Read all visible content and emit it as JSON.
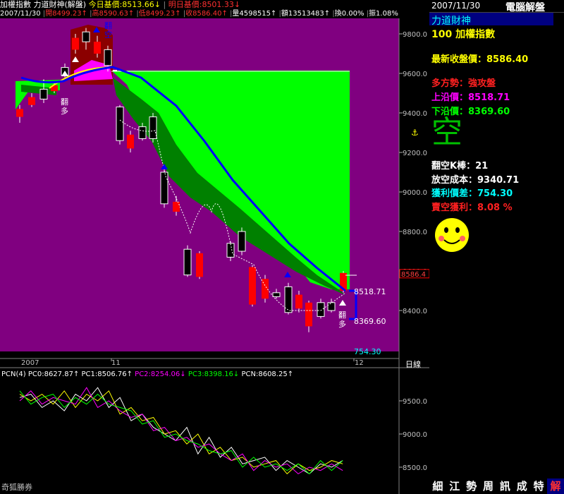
{
  "header": {
    "index_name": "加權指數",
    "indicator": "力道財神(解盤)",
    "today_base": "今日基價:8513.66↓",
    "tomorrow_base": "明日基價:8501.33↓",
    "date": "2007/11/30",
    "open": "開8499.23↑",
    "high": "高8590.63↑",
    "low": "低8499.23↑",
    "close": "收8586.40↑",
    "volume": "量4598515↑",
    "amount": "額13513483↑",
    "turnover": "換0.00%",
    "amplitude": "振1.08%"
  },
  "main_chart": {
    "y_ticks": [
      "9800.0",
      "9600.0",
      "9400.0",
      "9200.0",
      "9000.0",
      "8800.0",
      "8600.0",
      "8400.0"
    ],
    "current_price_tag": "8586.4",
    "upper_label": "8518.71",
    "lower_label": "8369.60",
    "profit_label": "754.30",
    "flip_long_label": "翻多",
    "flip_short_label": "翻空",
    "x_labels": [
      "2007",
      "11",
      "12"
    ],
    "period": "日線"
  },
  "sub_chart": {
    "legend": {
      "name": "PCN(4)",
      "pc0": "PC0:8627.87↑",
      "pc1": "PC1:8506.76↑",
      "pc2": "PC2:8254.06↓",
      "pc3": "PC3:8398.16↓",
      "pcn": "PCN:8608.25↑"
    },
    "y_ticks": [
      "9500.0",
      "9000.0",
      "8500.0"
    ],
    "broker": "奇狐勝券"
  },
  "side": {
    "date": "2007/11/30",
    "title": "電腦解盤",
    "indicator": "力道財神",
    "symbol": "100 加權指數",
    "last_close": "最新收盤價：8586.40",
    "trend": "多方勢：強攻盤",
    "upper": "上沿價：8518.71",
    "lower": "下沿價：8369.60",
    "state_char": "空",
    "short_bars": "翻空K棒：21",
    "short_cost": "放空成本：9340.71",
    "profit_diff": "獲利價差：754.30",
    "profit_pct": "賣空獲利：8.08 %",
    "toolbar": [
      "細",
      "江",
      "勢",
      "周",
      "訊",
      "成",
      "特",
      "解"
    ]
  },
  "colors": {
    "purple_bg": "#800080",
    "green_band": "#00ff00",
    "dark_green": "#008000",
    "blue_line": "#0000ff",
    "red_candle": "#ff0000",
    "yellow": "#ffff00",
    "cyan": "#00ffff"
  }
}
